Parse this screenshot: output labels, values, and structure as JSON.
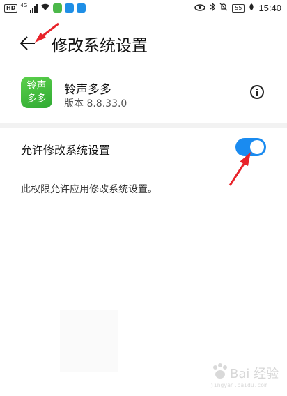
{
  "status_bar": {
    "hd": "HD",
    "network": "4G",
    "battery": "55",
    "time": "15:40"
  },
  "header": {
    "title": "修改系统设置"
  },
  "app": {
    "icon_text_line1": "铃声",
    "icon_text_line2": "多多",
    "name": "铃声多多",
    "version": "版本 8.8.33.0"
  },
  "permission": {
    "label": "允许修改系统设置",
    "enabled": true,
    "description": "此权限允许应用修改系统设置。"
  },
  "watermark": {
    "text": "Bai 经验",
    "sub": "jingyan.baidu.com"
  },
  "colors": {
    "toggle_on": "#1a8bf0",
    "app_icon": "#3dbb3a",
    "annotation_arrow": "#e8232a"
  }
}
